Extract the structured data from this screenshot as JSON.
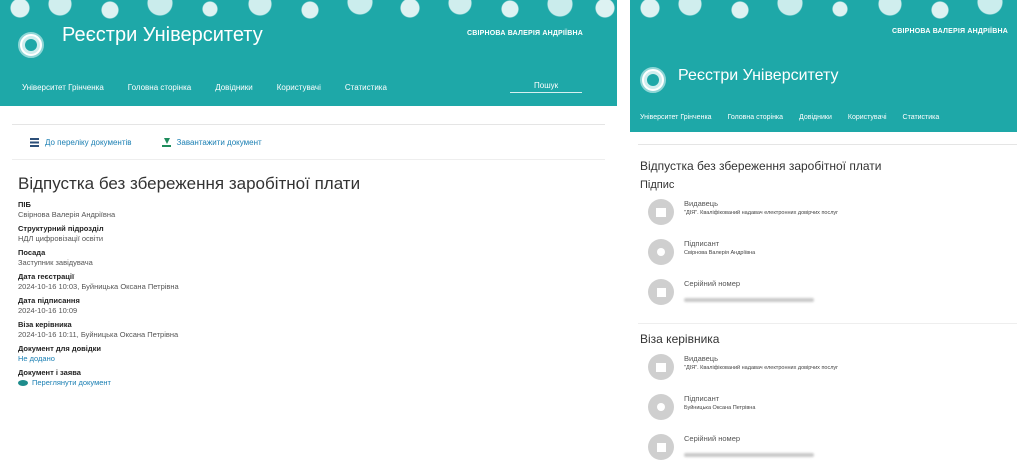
{
  "colors": {
    "header_teal": "#1ea8a8",
    "link": "#1a7fb3"
  },
  "left": {
    "header": {
      "site_title": "Реєстри Університету",
      "user_name": "СВІРНОВА ВАЛЕРІЯ АНДРІЇВНА",
      "nav": [
        "Університет Грінченка",
        "Головна сторінка",
        "Довідники",
        "Користувачі",
        "Статистика"
      ],
      "search_placeholder": "Пошук"
    },
    "toolbar": {
      "back_label": "До переліку документів",
      "download_label": "Завантажити документ"
    },
    "document": {
      "title": "Відпустка без збереження заробітної плати",
      "fields": [
        {
          "label": "ПІБ",
          "value": "Свірнова Валерія Андріївна"
        },
        {
          "label": "Структурний підрозділ",
          "value": "НДЛ цифровізації освіти"
        },
        {
          "label": "Посада",
          "value": "Заступник завідувача"
        },
        {
          "label": "Дата reєстрації",
          "value": "2024-10-16 10:03, Буйницька Оксана Петрівна"
        },
        {
          "label": "Дата підписання",
          "value": "2024-10-16 10:09"
        },
        {
          "label": "Віза керівника",
          "value": "2024-10-16 10:11, Буйницька Оксана Петрівна"
        },
        {
          "label": "Документ для довідки",
          "value": "Не додано"
        },
        {
          "label": "Документ і заява",
          "value": "Переглянути документ"
        }
      ]
    }
  },
  "right": {
    "header": {
      "user_name": "СВІРНОВА ВАЛЕРІЯ АНДРІЇВНА",
      "site_title": "Реєстри Університету",
      "nav": [
        "Університет Грінченка",
        "Головна сторінка",
        "Довідники",
        "Користувачі",
        "Статистика"
      ]
    },
    "title": "Відпустка без збереження заробітної плати",
    "signature": {
      "heading": "Підпис",
      "issuer_label": "Видавець",
      "issuer_value": "\"ДІЯ\". Кваліфікований надавач електронних довірчих послуг",
      "signer_label": "Підписант",
      "signer_value": "Свірнова Валерія Андріївна",
      "serial_label": "Серійний номер"
    },
    "visa": {
      "heading": "Віза керівника",
      "issuer_label": "Видавець",
      "issuer_value": "\"ДІЯ\". Кваліфікований надавач електронних довірчих послуг",
      "signer_label": "Підписант",
      "signer_value": "Буйницька Оксана Петрівна",
      "serial_label": "Серійний номер"
    }
  }
}
